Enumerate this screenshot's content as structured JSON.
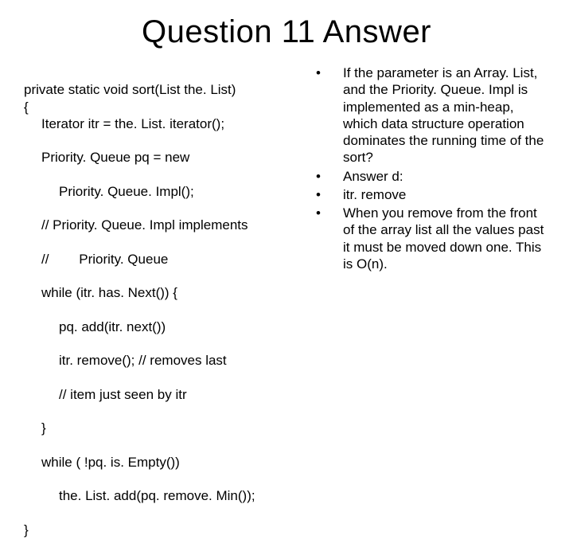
{
  "title": "Question 11 Answer",
  "code": {
    "l0": "private static void sort(List the. List)",
    "l1": "{",
    "l2": "Iterator itr = the. List. iterator();",
    "l3": "Priority. Queue pq = new",
    "l4": "Priority. Queue. Impl();",
    "l5": "// Priority. Queue. Impl implements",
    "l6": "//        Priority. Queue",
    "l7": "while (itr. has. Next()) {",
    "l8": "pq. add(itr. next())",
    "l9": "itr. remove(); // removes last",
    "l10": "// item just seen by itr",
    "l11": "}",
    "l12": "while ( !pq. is. Empty())",
    "l13": "the. List. add(pq. remove. Min());",
    "l14": "}"
  },
  "bullets": [
    "If the parameter is an Array. List, and the Priority. Queue. Impl is implemented as a min-heap, which data structure operation dominates the running time of the sort?",
    "Answer d:",
    "itr. remove",
    "When you remove from the front of the array list all the values past it must be moved down one. This is O(n)."
  ]
}
